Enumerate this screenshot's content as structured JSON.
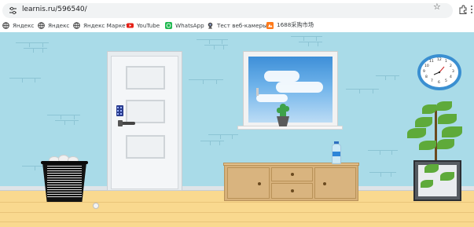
{
  "browser": {
    "url": "learnis.ru/596540/",
    "bookmarks": [
      {
        "label": "Яндекс",
        "icon": "globe-icon"
      },
      {
        "label": "Яндекс",
        "icon": "globe-icon"
      },
      {
        "label": "Яндекс Маркет",
        "icon": "globe-icon"
      },
      {
        "label": "YouTube",
        "icon": "youtube-icon"
      },
      {
        "label": "WhatsApp",
        "icon": "whatsapp-icon"
      },
      {
        "label": "Тест веб-камеры",
        "icon": "webcam-icon"
      },
      {
        "label": "1688采购市场",
        "icon": "shop-icon"
      }
    ]
  },
  "clock": {
    "numerals": [
      "12",
      "1",
      "2",
      "3",
      "4",
      "5",
      "6",
      "7",
      "8",
      "9",
      "10",
      "11"
    ]
  },
  "colors": {
    "wall": "#a9dbe8",
    "floor": "#f9d98f",
    "cabinet": "#d6b07a",
    "clock_rim": "#3a8fd1"
  }
}
